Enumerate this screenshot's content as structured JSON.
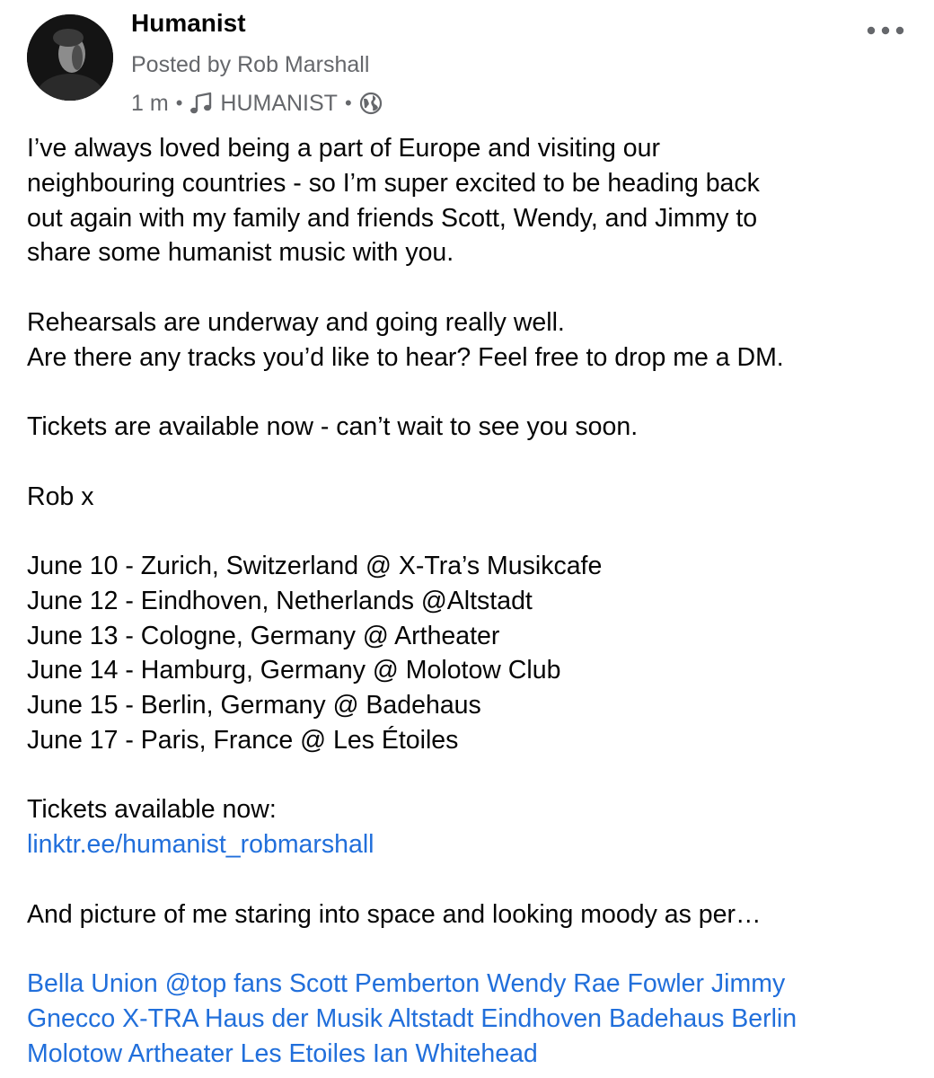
{
  "post": {
    "page_name": "Humanist",
    "posted_by": "Posted by Rob Marshall",
    "time": "1 m",
    "separator": "•",
    "group": "HUMANIST",
    "icons": {
      "avatar": "profile-photo",
      "music": "music-note-icon",
      "audience": "globe-icon",
      "more": "more-dots-icon"
    },
    "colors": {
      "text": "#050505",
      "secondary": "#65676b",
      "link": "#216fdb"
    }
  },
  "body": {
    "intro": [
      "I’ve always loved being a part of Europe and visiting our",
      "neighbouring countries - so I’m super excited to be heading back",
      "out again with my family and friends Scott, Wendy, and Jimmy to",
      "share some humanist music with you."
    ],
    "rehearsals": [
      "Rehearsals are underway and going really well.",
      "Are there any tracks you’d like to hear? Feel free to drop me a DM."
    ],
    "tickets_line": "Tickets are available now - can’t wait to see you soon.",
    "signoff": "Rob x",
    "tour_dates": [
      "June 10 - Zurich, Switzerland @ X-Tra’s Musikcafe",
      "June 12 - Eindhoven, Netherlands @Altstadt",
      "June 13 - Cologne, Germany @ Artheater",
      "June 14 - Hamburg, Germany @ Molotow Club",
      "June 15 - Berlin, Germany @ Badehaus",
      "June 17 - Paris, France @ Les Étoiles"
    ],
    "tickets_label": "Tickets available now:",
    "tickets_link": "linktr.ee/humanist_robmarshall",
    "picture_note": "And picture of me staring into space and looking moody as per…",
    "tag_lines": [
      [
        "Bella Union",
        "@top fans",
        "Scott Pemberton",
        "Wendy Rae Fowler",
        "Jimmy"
      ],
      [
        "Gnecco",
        "X-TRA Haus der Musik",
        "Altstadt Eindhoven",
        "Badehaus Berlin"
      ],
      [
        "Molotow",
        "Artheater",
        "Les Etoiles",
        "Ian Whitehead"
      ]
    ]
  }
}
